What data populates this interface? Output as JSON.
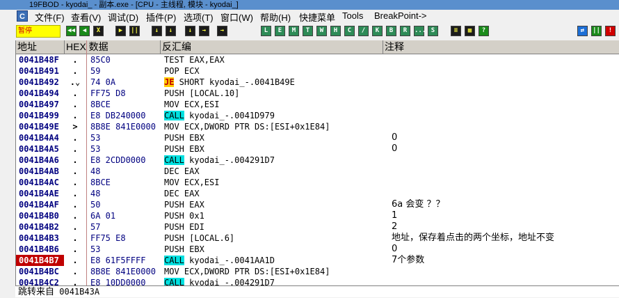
{
  "window": {
    "title": "19FBOD - kyodai_ - 副本.exe - [CPU - 主线程, 模块 - kyodai_]"
  },
  "menu": [
    "文件(F)",
    "查看(V)",
    "调试(D)",
    "插件(P)",
    "选项(T)",
    "窗口(W)",
    "帮助(H)",
    "快捷菜单",
    "Tools",
    "BreakPoint->"
  ],
  "toolbar": {
    "status": "暂停",
    "left_buttons": [
      "◀◀",
      "◀",
      "X",
      "▶",
      "||",
      "↓",
      "↓",
      "↓",
      "→",
      "→"
    ],
    "letter_buttons": [
      "L",
      "E",
      "M",
      "T",
      "W",
      "H",
      "C",
      "/",
      "K",
      "B",
      "R",
      "...",
      "S"
    ],
    "right_buttons": [
      "≡",
      "▦",
      "?"
    ],
    "far_right": [
      "⇄",
      "||",
      "!"
    ]
  },
  "columns": {
    "addr": "地址",
    "hex": "HEX 数据",
    "disasm": "反汇编",
    "comment": "注释"
  },
  "rows": [
    {
      "addr": "0041B48F",
      "flag": ".",
      "hex": "85C0",
      "op": "TEST EAX,EAX",
      "kw": "",
      "comment": ""
    },
    {
      "addr": "0041B491",
      "flag": ".",
      "hex": "59",
      "op": "POP ECX",
      "kw": "",
      "comment": ""
    },
    {
      "addr": "0041B492",
      "flag": ".⌄",
      "hex": "74 0A",
      "op": " SHORT kyodai_-.0041B49E",
      "kw": "JE",
      "comment": ""
    },
    {
      "addr": "0041B494",
      "flag": ".",
      "hex": "FF75 D8",
      "op": "PUSH [LOCAL.10]",
      "kw": "",
      "comment": ""
    },
    {
      "addr": "0041B497",
      "flag": ".",
      "hex": "8BCE",
      "op": "MOV ECX,ESI",
      "kw": "",
      "comment": ""
    },
    {
      "addr": "0041B499",
      "flag": ".",
      "hex": "E8 DB240000",
      "op": " kyodai_-.0041D979",
      "kw": "CALL",
      "comment": ""
    },
    {
      "addr": "0041B49E",
      "flag": ">",
      "hex": "8B8E 841E0000",
      "op": "MOV ECX,DWORD PTR DS:[ESI+0x1E84]",
      "kw": "",
      "comment": ""
    },
    {
      "addr": "0041B4A4",
      "flag": ".",
      "hex": "53",
      "op": "PUSH EBX",
      "kw": "",
      "comment": "0"
    },
    {
      "addr": "0041B4A5",
      "flag": ".",
      "hex": "53",
      "op": "PUSH EBX",
      "kw": "",
      "comment": "0"
    },
    {
      "addr": "0041B4A6",
      "flag": ".",
      "hex": "E8 2CDD0000",
      "op": " kyodai_-.004291D7",
      "kw": "CALL",
      "comment": ""
    },
    {
      "addr": "0041B4AB",
      "flag": ".",
      "hex": "48",
      "op": "DEC EAX",
      "kw": "",
      "comment": ""
    },
    {
      "addr": "0041B4AC",
      "flag": ".",
      "hex": "8BCE",
      "op": "MOV ECX,ESI",
      "kw": "",
      "comment": ""
    },
    {
      "addr": "0041B4AE",
      "flag": ".",
      "hex": "48",
      "op": "DEC EAX",
      "kw": "",
      "comment": ""
    },
    {
      "addr": "0041B4AF",
      "flag": ".",
      "hex": "50",
      "op": "PUSH EAX",
      "kw": "",
      "comment": "6a 会变 ？？"
    },
    {
      "addr": "0041B4B0",
      "flag": ".",
      "hex": "6A 01",
      "op": "PUSH 0x1",
      "kw": "",
      "comment": "1"
    },
    {
      "addr": "0041B4B2",
      "flag": ".",
      "hex": "57",
      "op": "PUSH EDI",
      "kw": "",
      "comment": "2"
    },
    {
      "addr": "0041B4B3",
      "flag": ".",
      "hex": "FF75 E8",
      "op": "PUSH [LOCAL.6]",
      "kw": "",
      "comment": "地址，保存着点击的两个坐标，地址不变"
    },
    {
      "addr": "0041B4B6",
      "flag": ".",
      "hex": "53",
      "op": "PUSH EBX",
      "kw": "",
      "comment": "0"
    },
    {
      "addr": "0041B4B7",
      "flag": ".",
      "hex": "E8 61F5FFFF",
      "op": " kyodai_-.0041AA1D",
      "kw": "CALL",
      "comment": "7个参数",
      "selected": true
    },
    {
      "addr": "0041B4BC",
      "flag": ".",
      "hex": "8B8E 841E0000",
      "op": "MOV ECX,DWORD PTR DS:[ESI+0x1E84]",
      "kw": "",
      "comment": ""
    },
    {
      "addr": "0041B4C2",
      "flag": ".",
      "hex": "E8 10DD0000",
      "op": " kyodai_-.004291D7",
      "kw": "CALL",
      "comment": ""
    }
  ],
  "info": {
    "label": "跳转来自",
    "value": "0041B43A"
  }
}
